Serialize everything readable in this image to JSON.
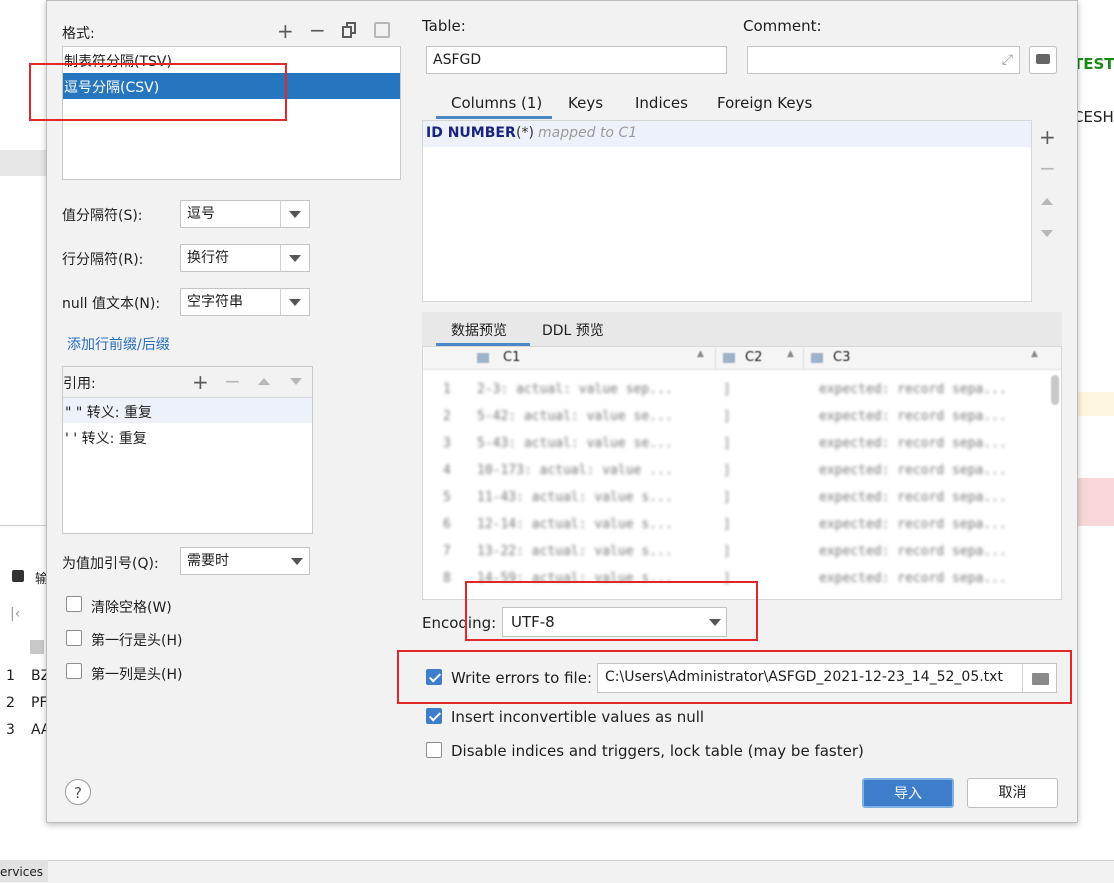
{
  "background": {
    "right_text_1": "TEST_",
    "right_text_2": "CESHI",
    "left_row_nums": [
      "1",
      "2",
      "3"
    ],
    "left_row_vals": [
      "BZ",
      "PF",
      "AA"
    ],
    "left_export_label": "输",
    "services_label": "ervices"
  },
  "format": {
    "label": "格式:",
    "items": [
      "制表符分隔(TSV)",
      "逗号分隔(CSV)"
    ],
    "selected_index": 1
  },
  "value_separator": {
    "label": "值分隔符(S):",
    "value": "逗号"
  },
  "row_separator": {
    "label": "行分隔符(R):",
    "value": "换行符"
  },
  "null_text": {
    "label": "null 值文本(N):",
    "value": "空字符串"
  },
  "add_prefix_link": "添加行前缀/后缀",
  "quote": {
    "label": "引用:",
    "items": [
      "\" \" 转义: 重复",
      "' ' 转义: 重复"
    ]
  },
  "quote_values": {
    "label": "为值加引号(Q):",
    "value": "需要时"
  },
  "checkboxes_left": [
    {
      "label": "清除空格(W)",
      "checked": false
    },
    {
      "label": "第一行是头(H)",
      "checked": false
    },
    {
      "label": "第一列是头(H)",
      "checked": false
    }
  ],
  "table": {
    "label": "Table:",
    "value": "ASFGD"
  },
  "comment": {
    "label": "Comment:",
    "value": ""
  },
  "tabs_top": [
    "Columns (1)",
    "Keys",
    "Indices",
    "Foreign Keys"
  ],
  "column_row": {
    "name": "ID NUMBER",
    "star": "(*)",
    "mapped": "mapped to C1"
  },
  "tabs_preview": [
    "数据预览",
    "DDL 预览"
  ],
  "preview": {
    "headers": [
      "C1",
      "C2",
      "C3"
    ],
    "rows": [
      [
        "1",
        "2-3: actual: value sep...",
        "]",
        "expected: record sepa..."
      ],
      [
        "2",
        "5-42: actual: value se...",
        "]",
        "expected: record sepa..."
      ],
      [
        "3",
        "5-43: actual: value se...",
        "]",
        "expected: record sepa..."
      ],
      [
        "4",
        "10-173: actual: value ...",
        "]",
        "expected: record sepa..."
      ],
      [
        "5",
        "11-43: actual: value s...",
        "]",
        "expected: record sepa..."
      ],
      [
        "6",
        "12-14: actual: value s...",
        "]",
        "expected: record sepa..."
      ],
      [
        "7",
        "13-22: actual: value s...",
        "]",
        "expected: record sepa..."
      ],
      [
        "8",
        "14-59: actual: value s...",
        "]",
        "expected: record sepa..."
      ]
    ]
  },
  "encoding": {
    "label": "Encoding:",
    "value": "UTF-8"
  },
  "write_errors": {
    "label": "Write errors to file:",
    "checked": true,
    "path": "C:\\Users\\Administrator\\ASFGD_2021-12-23_14_52_05.txt"
  },
  "insert_null": {
    "label": "Insert inconvertible values as null",
    "checked": true
  },
  "disable_indices": {
    "label": "Disable indices and triggers, lock table (may be faster)",
    "checked": false
  },
  "help_icon": "?",
  "buttons": {
    "ok": "导入",
    "cancel": "取消"
  },
  "colors": {
    "selection": "#2675bf",
    "accent": "#3d7dca",
    "annotation": "#e02828"
  }
}
